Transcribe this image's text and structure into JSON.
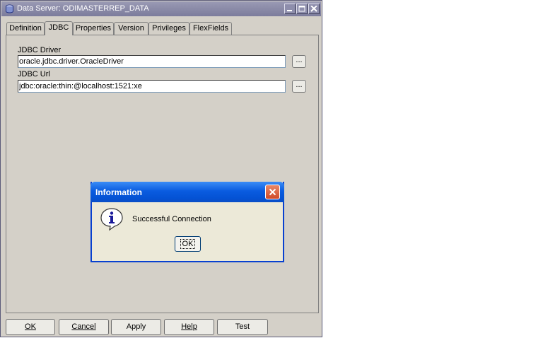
{
  "window": {
    "title": "Data Server: ODIMASTERREP_DATA",
    "title_bar_color": "#7c7c9c",
    "background": "#d4d0c8",
    "caption_buttons": [
      "minimize-icon",
      "maximize-icon",
      "close-icon"
    ]
  },
  "tabs": [
    {
      "label": "Definition",
      "active": false
    },
    {
      "label": "JDBC",
      "active": true
    },
    {
      "label": "Properties",
      "active": false
    },
    {
      "label": "Version",
      "active": false
    },
    {
      "label": "Privileges",
      "active": false
    },
    {
      "label": "FlexFields",
      "active": false
    }
  ],
  "jdbc": {
    "driver_label": "JDBC Driver",
    "driver_value": "oracle.jdbc.driver.OracleDriver",
    "url_label": "JDBC Url",
    "url_value": "jdbc:oracle:thin:@localhost:1521:xe",
    "browse_label": "..."
  },
  "buttons": {
    "ok": "OK",
    "cancel": "Cancel",
    "apply": "Apply",
    "help": "Help",
    "test": "Test"
  },
  "dialog": {
    "title": "Information",
    "message": "Successful Connection",
    "ok": "OK",
    "icon": "info-icon",
    "title_bar_color": "#0a5ce0"
  }
}
